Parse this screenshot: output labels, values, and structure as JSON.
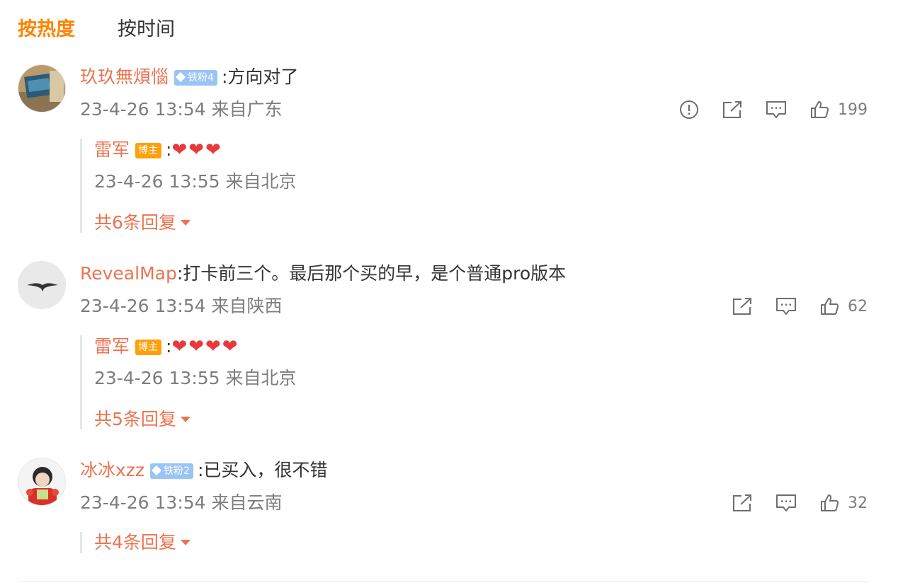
{
  "tabs": {
    "hot": "按热度",
    "time": "按时间"
  },
  "comments": [
    {
      "user": "玖玖無煩惱",
      "badge": "铁粉4",
      "text": ":方向对了",
      "meta": "23-4-26 13:54 来自广东",
      "likes": "199",
      "has_report": true,
      "reply": {
        "user": "雷军",
        "badge": "博主",
        "text": ":",
        "hearts": "❤❤❤",
        "meta": "23-4-26 13:55 来自北京"
      },
      "more": "共6条回复"
    },
    {
      "user": "RevealMap",
      "text": ":打卡前三个。最后那个买的早，是个普通pro版本",
      "meta": "23-4-26 13:54 来自陕西",
      "likes": "62",
      "reply": {
        "user": "雷军",
        "badge": "博主",
        "text": ":",
        "hearts": "❤❤❤❤",
        "meta": "23-4-26 13:55 来自北京"
      },
      "more": "共5条回复"
    },
    {
      "user": "冰冰xzz",
      "badge": "铁粉2",
      "text": ":已买入，很不错",
      "meta": "23-4-26 13:54 来自云南",
      "likes": "32",
      "more": "共4条回复"
    }
  ],
  "colors": {
    "accent": "#ff8200",
    "username": "#eb7350",
    "meta": "#7d7d7d",
    "fan_badge": "#9ac4f6",
    "host_badge": "#ffa00a",
    "heart": "#e83a3a"
  },
  "icons": {
    "report": "report-icon",
    "share": "share-icon",
    "comment": "comment-icon",
    "like": "thumbs-up-icon"
  }
}
